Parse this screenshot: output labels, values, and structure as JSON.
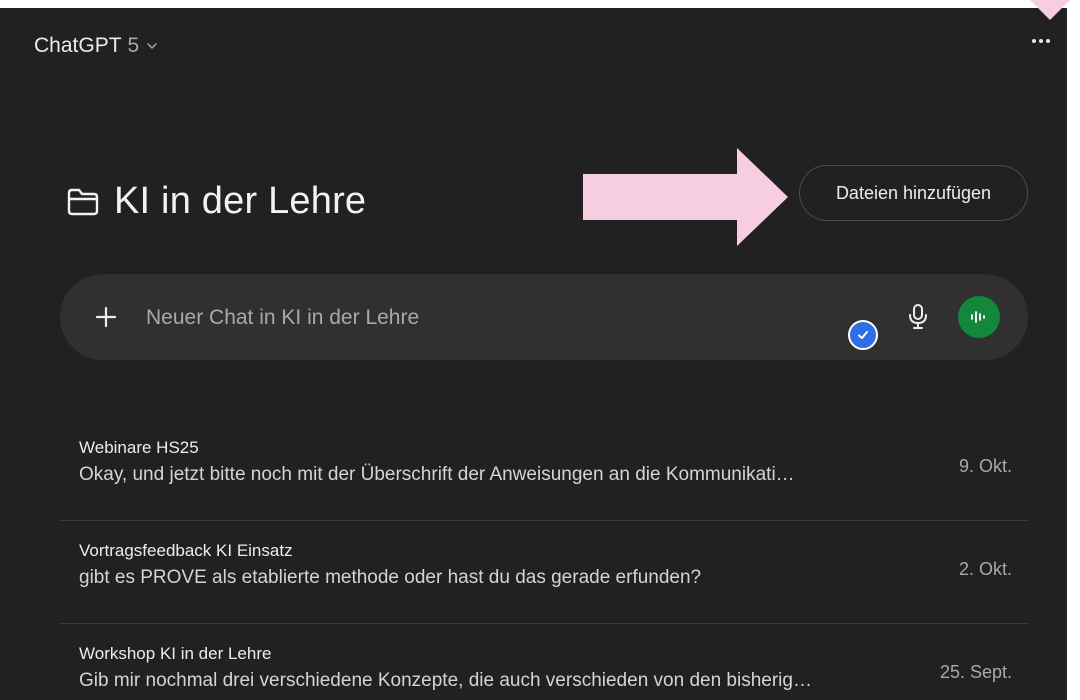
{
  "header": {
    "app_name": "ChatGPT",
    "version": "5"
  },
  "project": {
    "title": "KI in der Lehre",
    "add_files_label": "Dateien hinzufügen"
  },
  "composer": {
    "placeholder": "Neuer Chat in KI in der Lehre"
  },
  "chats": [
    {
      "title": "Webinare HS25",
      "snippet": "Okay, und jetzt bitte noch mit der Überschrift der Anweisungen an die Kommunikati…",
      "date": "9. Okt."
    },
    {
      "title": "Vortragsfeedback KI Einsatz",
      "snippet": "gibt es PROVE als etablierte methode oder hast du das gerade erfunden?",
      "date": "2. Okt."
    },
    {
      "title": "Workshop KI in der Lehre",
      "snippet": "Gib mir nochmal drei verschiedene Konzepte, die auch verschieden von den bisherig…",
      "date": "25. Sept."
    }
  ],
  "colors": {
    "background": "#212121",
    "composer": "#303030",
    "voice_button": "#13883d",
    "badge": "#2f6fe6",
    "annotation_arrow": "#f7cde2"
  },
  "icons": {
    "model_switch": "chevron-down-icon",
    "more": "more-dots-icon",
    "project": "folder-icon",
    "add": "plus-icon",
    "check": "check-badge-icon",
    "dictate": "microphone-icon",
    "voice": "voice-waveform-icon"
  }
}
